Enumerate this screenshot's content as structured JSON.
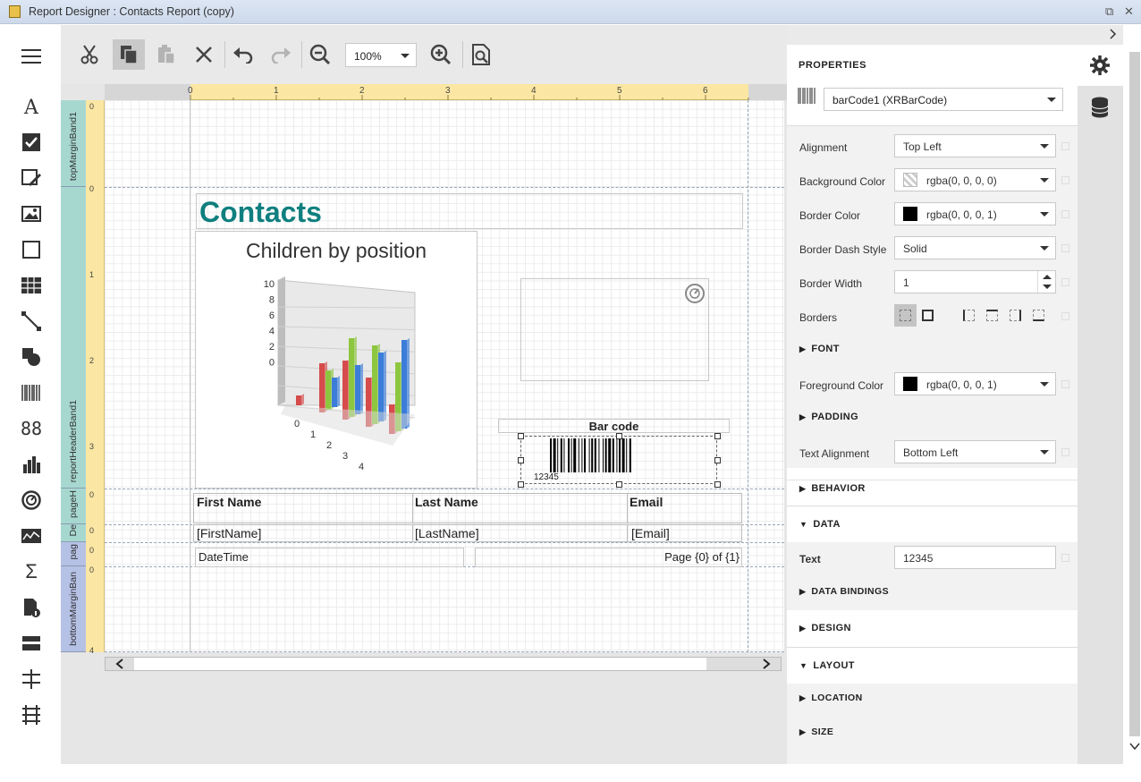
{
  "window": {
    "title": "Report Designer : Contacts Report (copy)"
  },
  "toolbox": {
    "items": [
      "menu-icon",
      "label-tool-icon",
      "checkbox-tool-icon",
      "rich-text-tool-icon",
      "picture-tool-icon",
      "panel-tool-icon",
      "table-tool-icon",
      "line-tool-icon",
      "shape-tool-icon",
      "barcode-tool-icon",
      "character-comb-tool-icon",
      "chart-tool-icon",
      "gauge-tool-icon",
      "sparkline-tool-icon",
      "summary-tool-icon",
      "page-info-tool-icon",
      "subreport-tool-icon",
      "page-break-tool-icon",
      "cross-band-line-tool-icon"
    ]
  },
  "toolbar": {
    "zoom": "100%"
  },
  "ruler": {
    "h_ticks": [
      "0",
      "1",
      "2",
      "3",
      "4",
      "5",
      "6"
    ],
    "v_ticks": [
      "0",
      "0",
      "1",
      "2",
      "3",
      "0",
      "0",
      "0",
      "0",
      "4"
    ]
  },
  "bands": [
    "topMarginBand1",
    "reportHeaderBand1",
    "pageH",
    "De",
    "pag",
    "bottomMarginBan"
  ],
  "report": {
    "title": "Contacts",
    "chart": {
      "title": "Children by position",
      "y_ticks": [
        "10",
        "8",
        "6",
        "4",
        "2",
        "0"
      ],
      "x_ticks": [
        "0",
        "1",
        "2",
        "3",
        "4"
      ]
    },
    "barcode_label": "Bar code",
    "barcode_text": "12345",
    "headers": [
      "First Name",
      "Last Name",
      "Email"
    ],
    "details": [
      "[FirstName]",
      "[LastName]",
      "[Email]"
    ],
    "footer_left": "DateTime",
    "footer_right": "Page {0} of {1}"
  },
  "chart_data": {
    "type": "bar",
    "title": "Children by position",
    "categories": [
      "0",
      "1",
      "2",
      "3",
      "4"
    ],
    "series": [
      {
        "values": [
          1,
          5,
          6,
          5,
          3
        ],
        "color": "#d64b4b"
      },
      {
        "values": [
          0,
          4,
          8,
          8,
          7
        ],
        "color": "#8dc63f"
      },
      {
        "values": [
          0,
          3,
          5,
          7,
          9
        ],
        "color": "#3b7dd8"
      }
    ],
    "ylim": [
      0,
      10
    ]
  },
  "properties": {
    "heading": "PROPERTIES",
    "selected": "barCode1 (XRBarCode)",
    "rows": {
      "alignment": {
        "label": "Alignment",
        "value": "Top Left"
      },
      "background": {
        "label": "Background Color",
        "value": "rgba(0, 0, 0, 0)"
      },
      "border_color": {
        "label": "Border Color",
        "value": "rgba(0, 0, 0, 1)"
      },
      "border_dash": {
        "label": "Border Dash Style",
        "value": "Solid"
      },
      "border_width": {
        "label": "Border Width",
        "value": "1"
      },
      "borders": {
        "label": "Borders"
      },
      "foreground": {
        "label": "Foreground Color",
        "value": "rgba(0, 0, 0, 1)"
      },
      "text_alignment": {
        "label": "Text Alignment",
        "value": "Bottom Left"
      },
      "text": {
        "label": "Text",
        "value": "12345"
      }
    },
    "sections": {
      "font": "FONT",
      "padding": "PADDING",
      "behavior": "BEHAVIOR",
      "data": "DATA",
      "data_bindings": "DATA BINDINGS",
      "design": "DESIGN",
      "layout": "LAYOUT",
      "location": "LOCATION",
      "size": "SIZE"
    }
  }
}
